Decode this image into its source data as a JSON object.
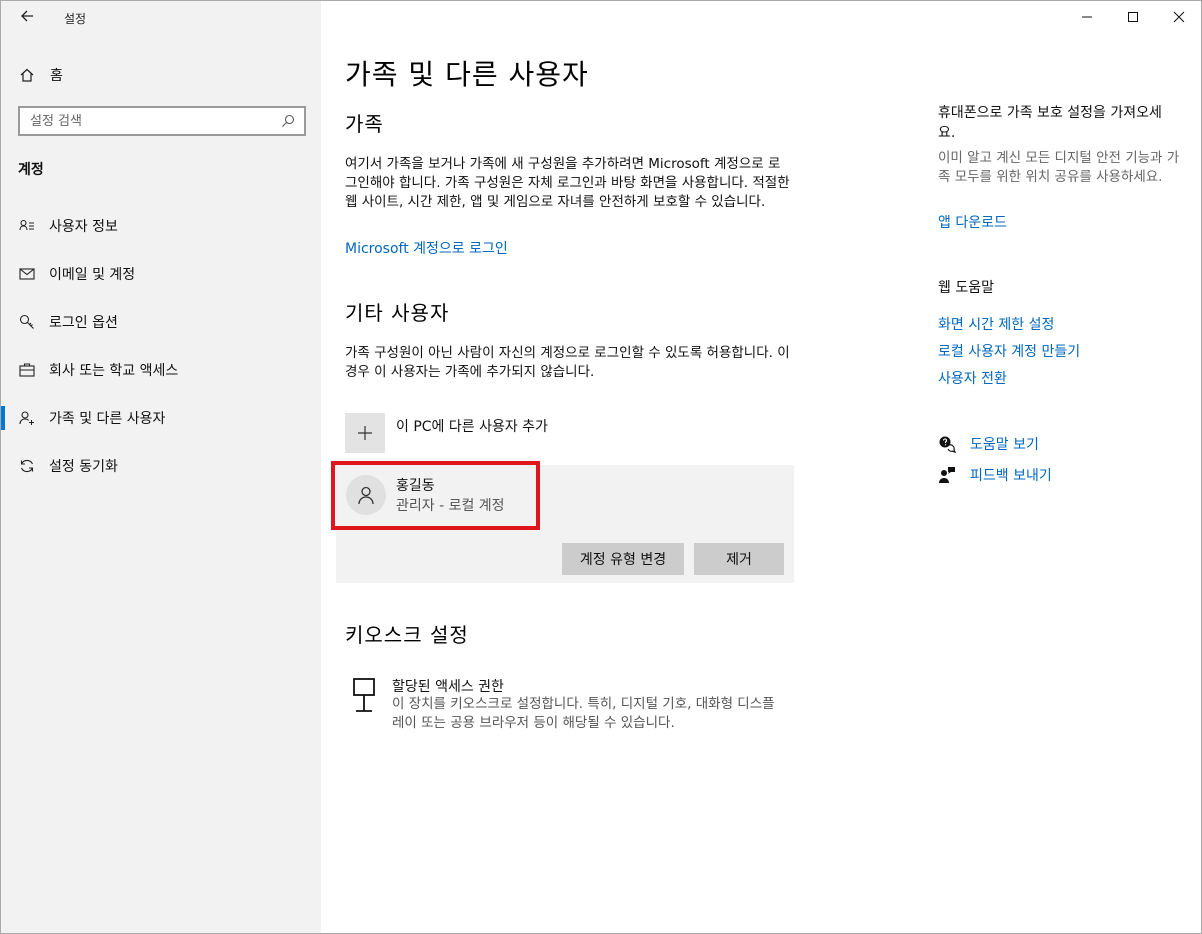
{
  "window": {
    "title": "설정"
  },
  "sidebar": {
    "home_label": "홈",
    "search_placeholder": "설정 검색",
    "section_label": "계정",
    "items": [
      {
        "label": "사용자 정보",
        "icon": "person-card-icon"
      },
      {
        "label": "이메일 및 계정",
        "icon": "mail-icon"
      },
      {
        "label": "로그인 옵션",
        "icon": "key-icon"
      },
      {
        "label": "회사 또는 학교 액세스",
        "icon": "briefcase-icon"
      },
      {
        "label": "가족 및 다른 사용자",
        "icon": "person-add-icon",
        "active": true
      },
      {
        "label": "설정 동기화",
        "icon": "sync-icon"
      }
    ]
  },
  "main": {
    "page_title": "가족 및 다른 사용자",
    "family": {
      "heading": "가족",
      "description": "여기서 가족을 보거나 가족에 새 구성원을 추가하려면 Microsoft 계정으로 로그인해야 합니다. 가족 구성원은 자체 로그인과 바탕 화면을 사용합니다. 적절한 웹 사이트, 시간 제한, 앱 및 게임으로 자녀를 안전하게 보호할 수 있습니다.",
      "signin_link": "Microsoft 계정으로 로그인"
    },
    "other_users": {
      "heading": "기타 사용자",
      "description": "가족 구성원이 아닌 사람이 자신의 계정으로 로그인할 수 있도록 허용합니다. 이 경우 이 사용자는 가족에 추가되지 않습니다.",
      "add_label": "이 PC에 다른 사용자 추가",
      "user": {
        "name": "홍길동",
        "type": "관리자 - 로컬 계정"
      },
      "change_type_button": "계정 유형 변경",
      "remove_button": "제거"
    },
    "kiosk": {
      "heading": "키오스크 설정",
      "title": "할당된 액세스 권한",
      "description": "이 장치를 키오스크로 설정합니다. 특히, 디지털 기호, 대화형 디스플레이 또는 공용 브라우저 등이 해당될 수 있습니다."
    }
  },
  "right_panel": {
    "phone_title": "휴대폰으로 가족 보호 설정을 가져오세요.",
    "phone_desc": "이미 알고 계신 모든 디지털 안전 기능과 가족 모두를 위한 위치 공유를 사용하세요.",
    "app_download": "앱 다운로드",
    "web_help_title": "웹 도움말",
    "web_links": [
      "화면 시간 제한 설정",
      "로컬 사용자 계정 만들기",
      "사용자 전환"
    ],
    "help_link": "도움말 보기",
    "feedback_link": "피드백 보내기"
  },
  "colors": {
    "accent": "#0078d7",
    "link": "#0067c0",
    "highlight": "#e0161e"
  }
}
